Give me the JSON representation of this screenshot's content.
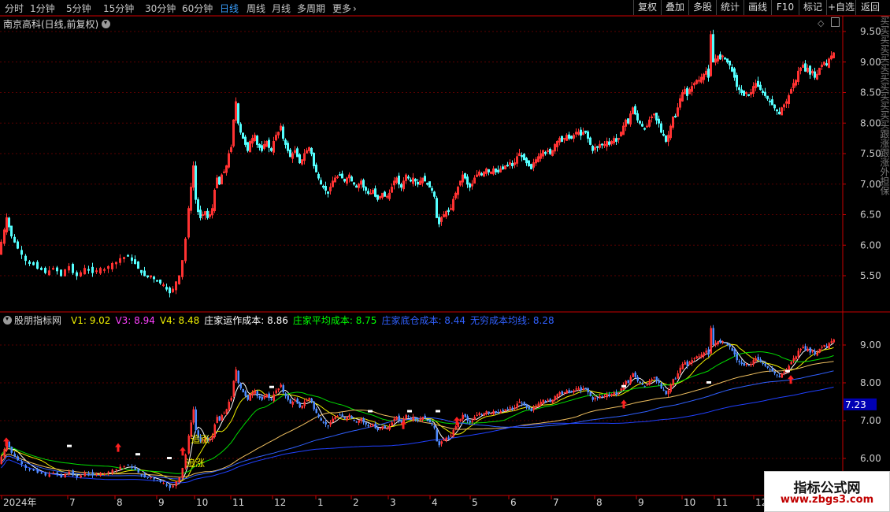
{
  "toolbar": {
    "periods": [
      "分时",
      "1分钟",
      "5分钟",
      "15分钟",
      "30分钟",
      "60分钟",
      "日线",
      "周线",
      "月线",
      "多周期",
      "更多"
    ],
    "active_period": "日线",
    "buttons": [
      "复权",
      "叠加",
      "多股",
      "统计",
      "画线",
      "F10",
      "标记",
      "+自选",
      "返回"
    ]
  },
  "stock": {
    "title": "南京高科(日线,前复权)"
  },
  "indicator": {
    "name": "股朋指标网",
    "values": [
      {
        "label": "V1: 9.02",
        "color": "#f0f000"
      },
      {
        "label": "V3: 8.94",
        "color": "#ff40ff"
      },
      {
        "label": "V4: 8.48",
        "color": "#f0f000"
      },
      {
        "label": "庄家运作成本: 8.86",
        "color": "#ffffff"
      },
      {
        "label": "庄家平均成本: 8.75",
        "color": "#00ff00"
      },
      {
        "label": "庄家底仓成本: 8.44",
        "color": "#3060ff"
      },
      {
        "label": "无穷成本均线: 8.28",
        "color": "#3060ff"
      }
    ],
    "signals": [
      "追涨",
      "追涨"
    ],
    "current_price_tag": "7.23"
  },
  "right_panel": {
    "partial_text": "买买买买买买买买买买买买跟涨跟涨外担保"
  },
  "watermark": {
    "line1": "指标公式网",
    "line2": "www.zbgs3.com"
  },
  "chart_data": [
    {
      "type": "candlestick",
      "title": "南京高科(日线,前复权)",
      "y_ticks": [
        "9.50",
        "9.00",
        "8.50",
        "8.00",
        "7.50",
        "7.00",
        "6.50",
        "6.00",
        "5.50"
      ],
      "ylim": [
        5.0,
        9.65
      ],
      "grid": true,
      "close_path": [
        [
          0,
          5.85
        ],
        [
          4,
          6.05
        ],
        [
          7,
          6.25
        ],
        [
          10,
          6.45
        ],
        [
          13,
          6.3
        ],
        [
          17,
          6.15
        ],
        [
          21,
          6.05
        ],
        [
          26,
          5.95
        ],
        [
          31,
          5.85
        ],
        [
          36,
          5.75
        ],
        [
          41,
          5.7
        ],
        [
          46,
          5.68
        ],
        [
          51,
          5.62
        ],
        [
          56,
          5.6
        ],
        [
          61,
          5.55
        ],
        [
          66,
          5.58
        ],
        [
          71,
          5.62
        ],
        [
          76,
          5.58
        ],
        [
          81,
          5.5
        ],
        [
          86,
          5.6
        ],
        [
          91,
          5.65
        ],
        [
          96,
          5.55
        ],
        [
          101,
          5.5
        ],
        [
          106,
          5.55
        ],
        [
          111,
          5.62
        ],
        [
          116,
          5.6
        ],
        [
          121,
          5.55
        ],
        [
          126,
          5.58
        ],
        [
          131,
          5.62
        ],
        [
          136,
          5.6
        ],
        [
          141,
          5.65
        ],
        [
          146,
          5.7
        ],
        [
          151,
          5.72
        ],
        [
          156,
          5.78
        ],
        [
          161,
          5.8
        ],
        [
          166,
          5.82
        ],
        [
          170,
          5.75
        ],
        [
          174,
          5.7
        ],
        [
          178,
          5.62
        ],
        [
          182,
          5.55
        ],
        [
          186,
          5.5
        ],
        [
          190,
          5.48
        ],
        [
          194,
          5.5
        ],
        [
          198,
          5.45
        ],
        [
          202,
          5.42
        ],
        [
          206,
          5.38
        ],
        [
          210,
          5.35
        ],
        [
          214,
          5.28
        ],
        [
          218,
          5.22
        ],
        [
          222,
          5.28
        ],
        [
          226,
          5.4
        ],
        [
          230,
          5.5
        ],
        [
          234,
          5.75
        ],
        [
          238,
          6.1
        ],
        [
          241,
          6.6
        ],
        [
          244,
          6.95
        ],
        [
          247,
          7.3
        ],
        [
          250,
          6.75
        ],
        [
          253,
          6.55
        ],
        [
          256,
          6.45
        ],
        [
          259,
          6.5
        ],
        [
          262,
          6.55
        ],
        [
          265,
          6.45
        ],
        [
          268,
          6.5
        ],
        [
          271,
          6.6
        ],
        [
          274,
          6.9
        ],
        [
          277,
          7.1
        ],
        [
          280,
          7.0
        ],
        [
          283,
          7.15
        ],
        [
          286,
          7.2
        ],
        [
          289,
          7.3
        ],
        [
          292,
          7.5
        ],
        [
          295,
          7.6
        ],
        [
          298,
          8.05
        ],
        [
          301,
          8.35
        ],
        [
          304,
          8.0
        ],
        [
          307,
          7.85
        ],
        [
          310,
          7.75
        ],
        [
          313,
          7.65
        ],
        [
          316,
          7.55
        ],
        [
          319,
          7.7
        ],
        [
          322,
          7.75
        ],
        [
          325,
          7.8
        ],
        [
          328,
          7.65
        ],
        [
          331,
          7.6
        ],
        [
          334,
          7.55
        ],
        [
          337,
          7.65
        ],
        [
          340,
          7.7
        ],
        [
          343,
          7.6
        ],
        [
          346,
          7.55
        ],
        [
          349,
          7.7
        ],
        [
          352,
          7.8
        ],
        [
          355,
          7.85
        ],
        [
          358,
          7.95
        ],
        [
          361,
          7.75
        ],
        [
          364,
          7.65
        ],
        [
          367,
          7.55
        ],
        [
          370,
          7.45
        ],
        [
          373,
          7.5
        ],
        [
          376,
          7.55
        ],
        [
          379,
          7.45
        ],
        [
          382,
          7.35
        ],
        [
          385,
          7.4
        ],
        [
          388,
          7.5
        ],
        [
          391,
          7.55
        ],
        [
          394,
          7.6
        ],
        [
          397,
          7.5
        ],
        [
          400,
          7.3
        ],
        [
          403,
          7.2
        ],
        [
          406,
          7.1
        ],
        [
          409,
          7.0
        ],
        [
          412,
          6.95
        ],
        [
          415,
          6.9
        ],
        [
          418,
          6.85
        ],
        [
          421,
          6.95
        ],
        [
          424,
          7.05
        ],
        [
          427,
          7.1
        ],
        [
          430,
          7.12
        ],
        [
          433,
          7.15
        ],
        [
          436,
          7.1
        ],
        [
          439,
          7.05
        ],
        [
          442,
          7.1
        ],
        [
          445,
          7.15
        ],
        [
          448,
          7.05
        ],
        [
          451,
          7.0
        ],
        [
          454,
          6.95
        ],
        [
          457,
          7.0
        ],
        [
          460,
          7.05
        ],
        [
          463,
          6.95
        ],
        [
          466,
          6.9
        ],
        [
          469,
          6.85
        ],
        [
          472,
          6.85
        ],
        [
          475,
          6.9
        ],
        [
          478,
          6.8
        ],
        [
          481,
          6.75
        ],
        [
          484,
          6.8
        ],
        [
          487,
          6.85
        ],
        [
          490,
          6.8
        ],
        [
          493,
          6.8
        ],
        [
          496,
          6.85
        ],
        [
          499,
          6.95
        ],
        [
          502,
          7.05
        ],
        [
          505,
          7.1
        ],
        [
          508,
          7.0
        ],
        [
          511,
          6.95
        ],
        [
          514,
          7.05
        ],
        [
          517,
          7.15
        ],
        [
          520,
          7.1
        ],
        [
          523,
          7.05
        ],
        [
          526,
          7.1
        ],
        [
          529,
          7.05
        ],
        [
          532,
          7.0
        ],
        [
          535,
          7.05
        ],
        [
          538,
          7.1
        ],
        [
          541,
          7.05
        ],
        [
          544,
          7.0
        ],
        [
          547,
          6.95
        ],
        [
          550,
          6.9
        ],
        [
          553,
          6.8
        ],
        [
          556,
          6.45
        ],
        [
          559,
          6.35
        ],
        [
          562,
          6.45
        ],
        [
          565,
          6.5
        ],
        [
          568,
          6.55
        ],
        [
          571,
          6.55
        ],
        [
          574,
          6.6
        ],
        [
          577,
          6.75
        ],
        [
          580,
          6.85
        ],
        [
          583,
          6.95
        ],
        [
          586,
          7.05
        ],
        [
          589,
          7.15
        ],
        [
          592,
          7.1
        ],
        [
          595,
          7.0
        ],
        [
          598,
          6.95
        ],
        [
          601,
          7.0
        ],
        [
          604,
          7.1
        ],
        [
          607,
          7.15
        ],
        [
          610,
          7.2
        ],
        [
          613,
          7.15
        ],
        [
          616,
          7.2
        ],
        [
          619,
          7.25
        ],
        [
          622,
          7.2
        ],
        [
          625,
          7.2
        ],
        [
          628,
          7.25
        ],
        [
          631,
          7.2
        ],
        [
          634,
          7.2
        ],
        [
          637,
          7.25
        ],
        [
          640,
          7.25
        ],
        [
          643,
          7.3
        ],
        [
          646,
          7.3
        ],
        [
          649,
          7.35
        ],
        [
          652,
          7.3
        ],
        [
          655,
          7.35
        ],
        [
          658,
          7.45
        ],
        [
          661,
          7.5
        ],
        [
          664,
          7.45
        ],
        [
          667,
          7.4
        ],
        [
          670,
          7.35
        ],
        [
          673,
          7.3
        ],
        [
          676,
          7.25
        ],
        [
          679,
          7.35
        ],
        [
          682,
          7.4
        ],
        [
          685,
          7.45
        ],
        [
          688,
          7.5
        ],
        [
          691,
          7.55
        ],
        [
          694,
          7.5
        ],
        [
          697,
          7.55
        ],
        [
          700,
          7.5
        ],
        [
          703,
          7.55
        ],
        [
          706,
          7.65
        ],
        [
          709,
          7.7
        ],
        [
          712,
          7.75
        ],
        [
          715,
          7.7
        ],
        [
          718,
          7.75
        ],
        [
          721,
          7.8
        ],
        [
          724,
          7.75
        ],
        [
          727,
          7.75
        ],
        [
          730,
          7.8
        ],
        [
          733,
          7.85
        ],
        [
          736,
          7.85
        ],
        [
          739,
          7.8
        ],
        [
          742,
          7.85
        ],
        [
          745,
          7.85
        ],
        [
          748,
          7.75
        ],
        [
          751,
          7.65
        ],
        [
          754,
          7.55
        ],
        [
          757,
          7.6
        ],
        [
          760,
          7.6
        ],
        [
          763,
          7.65
        ],
        [
          766,
          7.65
        ],
        [
          769,
          7.65
        ],
        [
          772,
          7.7
        ],
        [
          775,
          7.65
        ],
        [
          778,
          7.7
        ],
        [
          781,
          7.75
        ],
        [
          784,
          7.7
        ],
        [
          787,
          7.75
        ],
        [
          790,
          7.85
        ],
        [
          793,
          7.95
        ],
        [
          796,
          8.05
        ],
        [
          799,
          8.0
        ],
        [
          802,
          8.15
        ],
        [
          805,
          8.25
        ],
        [
          808,
          8.15
        ],
        [
          811,
          8.05
        ],
        [
          814,
          8.0
        ],
        [
          817,
          7.95
        ],
        [
          820,
          7.9
        ],
        [
          823,
          7.95
        ],
        [
          826,
          8.05
        ],
        [
          829,
          8.1
        ],
        [
          832,
          8.15
        ],
        [
          835,
          8.05
        ],
        [
          838,
          8.0
        ],
        [
          841,
          7.85
        ],
        [
          844,
          7.8
        ],
        [
          847,
          7.7
        ],
        [
          850,
          7.8
        ],
        [
          853,
          7.95
        ],
        [
          856,
          8.1
        ],
        [
          859,
          8.1
        ],
        [
          862,
          8.25
        ],
        [
          865,
          8.4
        ],
        [
          868,
          8.5
        ],
        [
          871,
          8.55
        ],
        [
          874,
          8.45
        ],
        [
          877,
          8.55
        ],
        [
          880,
          8.6
        ],
        [
          883,
          8.65
        ],
        [
          886,
          8.7
        ],
        [
          889,
          8.7
        ],
        [
          892,
          8.75
        ],
        [
          895,
          8.8
        ],
        [
          898,
          8.85
        ],
        [
          901,
          8.75
        ],
        [
          904,
          9.45
        ],
        [
          907,
          9.0
        ],
        [
          910,
          9.05
        ],
        [
          913,
          9.1
        ],
        [
          916,
          9.05
        ],
        [
          919,
          9.1
        ],
        [
          922,
          9.05
        ],
        [
          925,
          9.0
        ],
        [
          928,
          8.95
        ],
        [
          931,
          8.85
        ],
        [
          934,
          8.75
        ],
        [
          937,
          8.6
        ],
        [
          940,
          8.55
        ],
        [
          943,
          8.5
        ],
        [
          946,
          8.45
        ],
        [
          949,
          8.5
        ],
        [
          952,
          8.45
        ],
        [
          955,
          8.5
        ],
        [
          958,
          8.6
        ],
        [
          961,
          8.65
        ],
        [
          964,
          8.6
        ],
        [
          967,
          8.55
        ],
        [
          970,
          8.5
        ],
        [
          973,
          8.45
        ],
        [
          976,
          8.4
        ],
        [
          979,
          8.35
        ],
        [
          982,
          8.3
        ],
        [
          985,
          8.25
        ],
        [
          988,
          8.2
        ],
        [
          991,
          8.15
        ],
        [
          994,
          8.25
        ],
        [
          997,
          8.3
        ],
        [
          1000,
          8.35
        ],
        [
          1003,
          8.45
        ],
        [
          1006,
          8.55
        ],
        [
          1009,
          8.65
        ],
        [
          1012,
          8.7
        ],
        [
          1015,
          8.85
        ],
        [
          1018,
          8.9
        ],
        [
          1021,
          8.95
        ],
        [
          1024,
          8.85
        ],
        [
          1027,
          8.9
        ],
        [
          1030,
          8.8
        ],
        [
          1033,
          8.85
        ],
        [
          1036,
          8.75
        ],
        [
          1039,
          8.8
        ],
        [
          1042,
          8.9
        ],
        [
          1045,
          8.95
        ],
        [
          1048,
          9.0
        ],
        [
          1051,
          8.95
        ],
        [
          1054,
          9.05
        ],
        [
          1057,
          9.1
        ],
        [
          1060,
          9.15
        ]
      ]
    },
    {
      "type": "line",
      "title": "股朋指标网",
      "y_ticks": [
        "9.00",
        "8.00",
        "7.00",
        "6.00"
      ],
      "ylim": [
        5.25,
        9.4
      ],
      "series": [
        {
          "name": "庄家运作成本",
          "color": "#ffffff"
        },
        {
          "name": "庄家平均成本",
          "color": "#00ff00"
        },
        {
          "name": "庄家底仓成本",
          "color": "#3060ff"
        },
        {
          "name": "无穷成本均线",
          "color": "#3060ff"
        }
      ],
      "x_ticks": [
        "2024年",
        "7",
        "8",
        "9",
        "10",
        "11",
        "12",
        "1",
        "2",
        "3",
        "4",
        "5",
        "6",
        "7",
        "8",
        "9",
        "10",
        "11",
        "12"
      ],
      "signals": [
        "追涨",
        "追涨"
      ]
    }
  ],
  "colors": {
    "up": "#ff3232",
    "down": "#54ffff",
    "grid": "#5a0000",
    "axis": "#c80000",
    "active_tab": "#3aa0ff"
  }
}
